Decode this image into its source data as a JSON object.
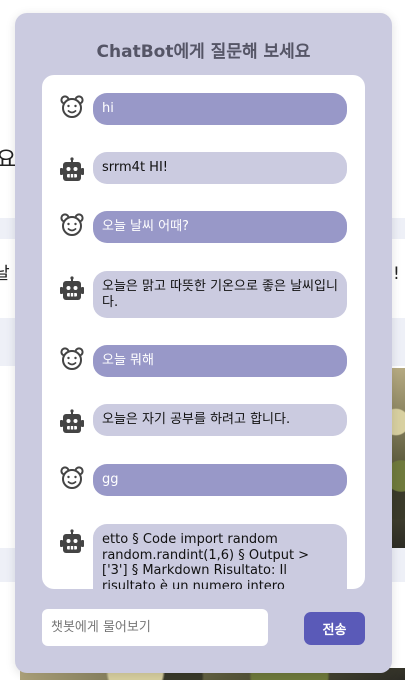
{
  "background_page": {
    "fragment_1": "요",
    "fragment_2": "날",
    "fragment_3": "!"
  },
  "chatbot": {
    "title": "ChatBot에게 질문해 보세요",
    "messages": [
      {
        "sender": "user",
        "avatar_icon": "bear-icon",
        "text": "hi"
      },
      {
        "sender": "bot",
        "avatar_icon": "robot-icon",
        "text": "srrm4t HI!"
      },
      {
        "sender": "user",
        "avatar_icon": "bear-icon",
        "text": "오늘 날씨 어때?"
      },
      {
        "sender": "bot",
        "avatar_icon": "robot-icon",
        "text": "오늘은 맑고 따뜻한 기온으로 좋은 날씨입니다."
      },
      {
        "sender": "user",
        "avatar_icon": "bear-icon",
        "text": "오늘 뭐해"
      },
      {
        "sender": "bot",
        "avatar_icon": "robot-icon",
        "text": "오늘은 자기 공부를 하려고 합니다."
      },
      {
        "sender": "user",
        "avatar_icon": "bear-icon",
        "text": "gg"
      },
      {
        "sender": "bot",
        "avatar_icon": "robot-icon",
        "text": "etto § Code import random random.randint(1,6) § Output > ['3'] § Markdown Risultato: Il risultato è un numero intero casuale"
      }
    ],
    "input": {
      "placeholder": "챗봇에게 물어보기",
      "value": ""
    },
    "send_label": "전송"
  },
  "colors": {
    "modal_bg": "#cbcbe0",
    "user_bubble": "#9898c8",
    "bot_bubble": "#cbcbe0",
    "send_button": "#5a5ab8"
  }
}
